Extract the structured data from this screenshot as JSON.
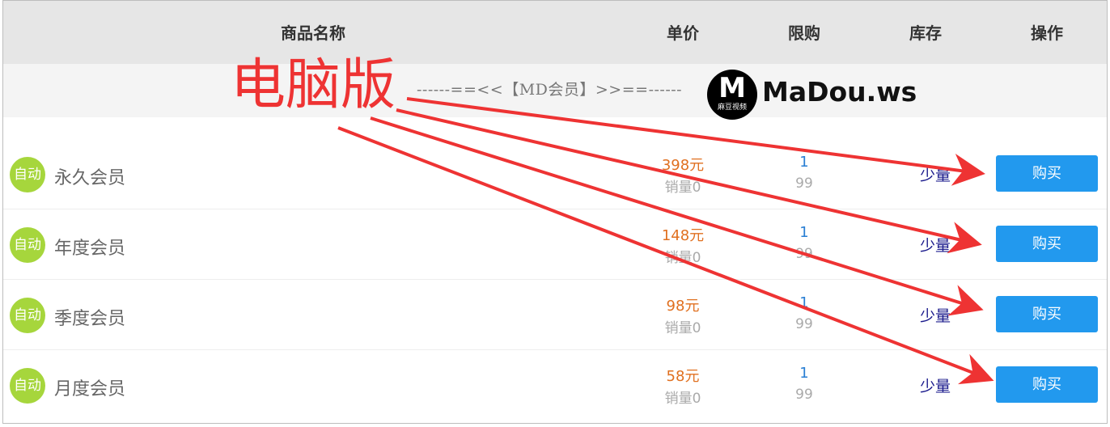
{
  "header": {
    "name": "商品名称",
    "price": "单价",
    "limit": "限购",
    "stock": "库存",
    "action": "操作"
  },
  "banner": {
    "divider": "------==<<【MD会员】>>==------",
    "logo_letter": "M",
    "logo_sub": "麻豆视频",
    "logo_text": "MaDou.ws"
  },
  "overlay_label": "电脑版",
  "colors": {
    "annotation": "#ee3333",
    "button": "#2299ee",
    "auto_badge": "#a6d63c",
    "price": "#e07020"
  },
  "products": [
    {
      "badge": "自动",
      "name": "永久会员",
      "price": "398元",
      "sold": "销量0",
      "limit": "1",
      "max": "99",
      "stock": "少量",
      "buy": "购买"
    },
    {
      "badge": "自动",
      "name": "年度会员",
      "price": "148元",
      "sold": "销量0",
      "limit": "1",
      "max": "99",
      "stock": "少量",
      "buy": "购买"
    },
    {
      "badge": "自动",
      "name": "季度会员",
      "price": "98元",
      "sold": "销量0",
      "limit": "1",
      "max": "99",
      "stock": "少量",
      "buy": "购买"
    },
    {
      "badge": "自动",
      "name": "月度会员",
      "price": "58元",
      "sold": "销量0",
      "limit": "1",
      "max": "99",
      "stock": "少量",
      "buy": "购买"
    }
  ]
}
